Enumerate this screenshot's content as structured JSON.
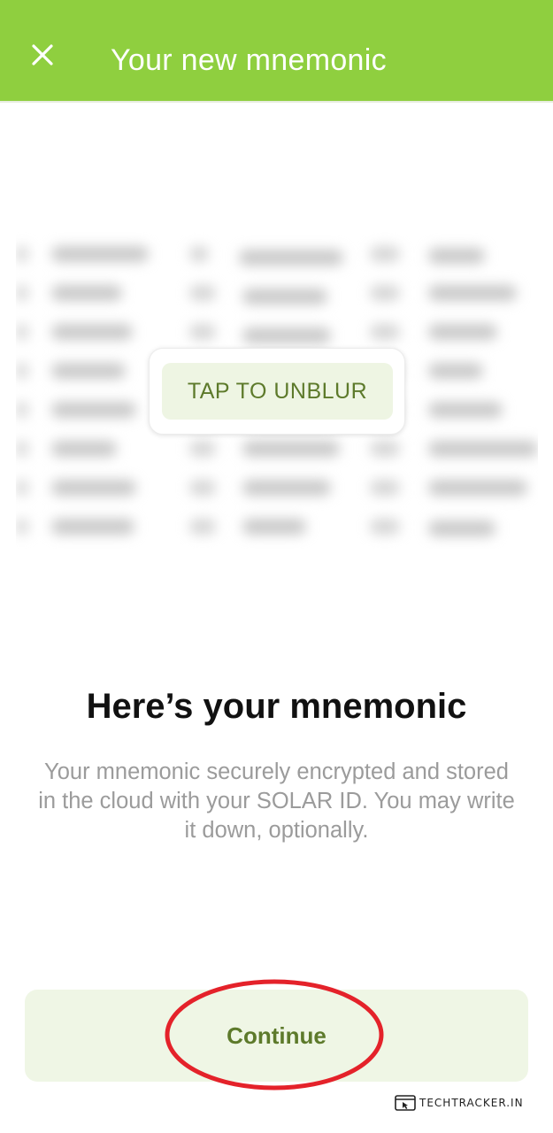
{
  "header": {
    "title": "Your new mnemonic",
    "close_icon": "close-icon",
    "background_color": "#8fcf3f"
  },
  "mnemonic": {
    "unblur_label": "TAP TO UNBLUR"
  },
  "content": {
    "headline": "Here’s your mnemonic",
    "description": "Your mnemonic securely encrypted and stored in the cloud with your SOLAR ID. You may write it down, optionally."
  },
  "footer": {
    "continue_label": "Continue",
    "accent_color": "#5d7a2b"
  },
  "watermark": {
    "text": "TECHTRACKER.IN"
  }
}
